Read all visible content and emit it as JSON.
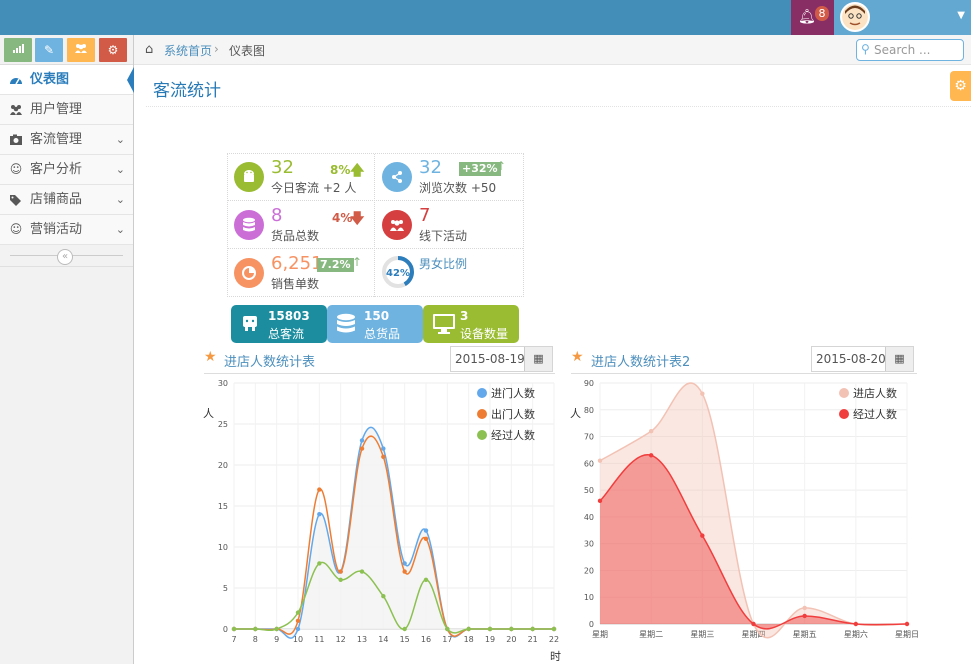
{
  "navbar": {
    "notification_count": "8",
    "bell_icon": "bell-icon",
    "caret_icon": "caret-down-icon"
  },
  "sidebar": {
    "shortcuts": [
      {
        "icon": "signal-icon",
        "color": "#87b87f"
      },
      {
        "icon": "pencil-icon",
        "color": "#6fb3e0"
      },
      {
        "icon": "group-icon",
        "color": "#ffb752"
      },
      {
        "icon": "cogs-icon",
        "color": "#d15b47"
      }
    ],
    "items": [
      {
        "label": "仪表图",
        "icon": "dashboard-icon",
        "active": true
      },
      {
        "label": "用户管理",
        "icon": "users-icon"
      },
      {
        "label": "客流管理",
        "icon": "camera-icon"
      },
      {
        "label": "客户分析",
        "icon": "smile-icon"
      },
      {
        "label": "店铺商品",
        "icon": "tags-icon"
      },
      {
        "label": "营销活动",
        "icon": "smile-icon"
      }
    ]
  },
  "breadcrumb": {
    "home": "系统首页",
    "current": "仪表图"
  },
  "search": {
    "placeholder": "Search ..."
  },
  "page": {
    "title": "客流统计"
  },
  "infoboxes": [
    {
      "value": "32",
      "label": "今日客流 +2 人",
      "stat": "8%",
      "trend": "up",
      "color": "#9abc32",
      "icon": "android-icon"
    },
    {
      "value": "32",
      "label": "浏览次数 +50",
      "badge": "+32%",
      "trend": "up",
      "color": "#6fb3e0",
      "icon": "share-icon"
    },
    {
      "value": "8",
      "label": "货品总数",
      "stat": "4%",
      "trend": "down",
      "color": "#cb6fd7",
      "icon": "database-icon"
    },
    {
      "value": "7",
      "label": "线下活动",
      "color": "#d53f40",
      "icon": "users-icon"
    },
    {
      "value": "6,251",
      "label": "销售单数",
      "badge": "7.2%",
      "trend": "up",
      "color": "#f79263",
      "icon": "pie-icon"
    },
    {
      "label": "男女比例",
      "pie_percent": "42%"
    }
  ],
  "bigstats": [
    {
      "number": "15803",
      "label": "总客流",
      "color": "#1b8d9f",
      "icon": "android-icon"
    },
    {
      "number": "150",
      "label": "总货品",
      "color": "#6fb3e0",
      "icon": "database-icon"
    },
    {
      "number": "3",
      "label": "设备数量",
      "color": "#9abc32",
      "icon": "desktop-icon"
    }
  ],
  "charts": [
    {
      "title": "进店人数统计表",
      "date": "2015-08-19",
      "ylabel": "人",
      "xlabel": "时"
    },
    {
      "title": "进店人数统计表2",
      "date": "2015-08-20",
      "ylabel": "人"
    }
  ],
  "chart_data": [
    {
      "type": "line",
      "title": "进店人数统计表",
      "ylabel": "人",
      "xlabel": "时",
      "x": [
        7,
        8,
        9,
        10,
        11,
        12,
        13,
        14,
        15,
        16,
        17,
        18,
        19,
        20,
        21,
        22
      ],
      "ylim": [
        0,
        30
      ],
      "yticks": [
        0,
        5,
        10,
        15,
        20,
        25,
        30
      ],
      "series": [
        {
          "name": "进门人数",
          "color": "#62a8ea",
          "values": [
            0,
            0,
            0,
            0,
            14,
            7,
            23,
            22,
            8,
            12,
            0,
            0,
            0,
            0,
            0,
            0
          ]
        },
        {
          "name": "出门人数",
          "color": "#ee7d33",
          "values": [
            0,
            0,
            0,
            1,
            17,
            7,
            22,
            21,
            7,
            11,
            0,
            0,
            0,
            0,
            0,
            0
          ]
        },
        {
          "name": "经过人数",
          "color": "#8cc152",
          "values": [
            0,
            0,
            0,
            2,
            8,
            6,
            7,
            4,
            0,
            6,
            0,
            0,
            0,
            0,
            0,
            0
          ]
        }
      ],
      "legend": "top-right",
      "grid": true
    },
    {
      "type": "area",
      "title": "进店人数统计表2",
      "ylabel": "人",
      "categories": [
        "星期",
        "星期二",
        "星期三",
        "星期四",
        "星期五",
        "星期六",
        "星期日"
      ],
      "ylim": [
        0,
        90
      ],
      "yticks": [
        0,
        10,
        20,
        30,
        40,
        50,
        60,
        70,
        80,
        90
      ],
      "series": [
        {
          "name": "进店人数",
          "color": "#f2c2b4",
          "values": [
            61,
            72,
            86,
            0,
            6,
            0,
            0
          ]
        },
        {
          "name": "经过人数",
          "color": "#f03e3e",
          "values": [
            46,
            63,
            33,
            0,
            3,
            0,
            0
          ]
        }
      ],
      "legend": "top-right",
      "grid": true
    }
  ]
}
